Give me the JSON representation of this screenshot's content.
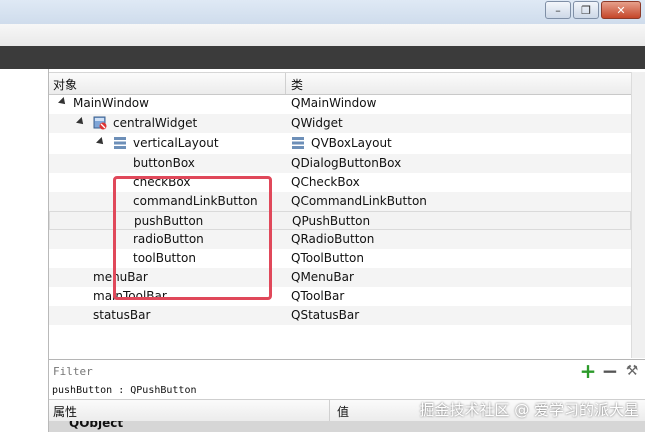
{
  "tree": {
    "col_object": "对象",
    "col_class": "类",
    "rows": [
      {
        "name": "MainWindow",
        "cls": "QMainWindow"
      },
      {
        "name": "centralWidget",
        "cls": "QWidget"
      },
      {
        "name": "verticalLayout",
        "cls": "QVBoxLayout"
      },
      {
        "name": "buttonBox",
        "cls": "QDialogButtonBox"
      },
      {
        "name": "checkBox",
        "cls": "QCheckBox"
      },
      {
        "name": "commandLinkButton",
        "cls": "QCommandLinkButton"
      },
      {
        "name": "pushButton",
        "cls": "QPushButton"
      },
      {
        "name": "radioButton",
        "cls": "QRadioButton"
      },
      {
        "name": "toolButton",
        "cls": "QToolButton"
      },
      {
        "name": "menuBar",
        "cls": "QMenuBar"
      },
      {
        "name": "mainToolBar",
        "cls": "QToolBar"
      },
      {
        "name": "statusBar",
        "cls": "QStatusBar"
      }
    ]
  },
  "filter": {
    "placeholder": "Filter"
  },
  "status_line": "pushButton : QPushButton",
  "props": {
    "col_property": "属性",
    "col_value": "值",
    "section": "QObject"
  },
  "watermark": "掘金技术社区 @ 爱学习的派大星",
  "window_buttons": {
    "minimize": "–",
    "restore": "❐",
    "close": "✕"
  }
}
